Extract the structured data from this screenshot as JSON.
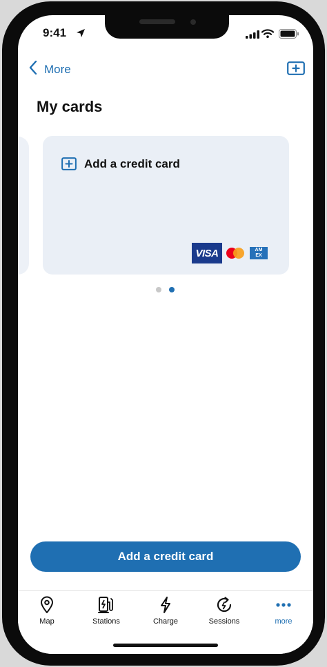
{
  "status_bar": {
    "time": "9:41"
  },
  "nav": {
    "back_label": "More",
    "back_icon": "chevron-left-icon",
    "add_icon": "add-card-icon"
  },
  "page": {
    "title": "My cards"
  },
  "card": {
    "label": "Add a credit card",
    "icon": "plus-square-icon",
    "logos": {
      "visa": "VISA",
      "amex_line1": "AM",
      "amex_line2": "EX"
    }
  },
  "carousel": {
    "total_pages": 2,
    "active_page": 2
  },
  "primary_button": {
    "label": "Add a credit card"
  },
  "tabs": [
    {
      "label": "Map",
      "icon": "map-pin-icon",
      "active": false
    },
    {
      "label": "Stations",
      "icon": "charging-station-icon",
      "active": false
    },
    {
      "label": "Charge",
      "icon": "lightning-icon",
      "active": false
    },
    {
      "label": "Sessions",
      "icon": "history-icon",
      "active": false
    },
    {
      "label": "more",
      "icon": "more-dots-icon",
      "active": true
    }
  ],
  "colors": {
    "accent": "#1f6fb2",
    "card_background": "#eaeff6",
    "text": "#111111"
  }
}
